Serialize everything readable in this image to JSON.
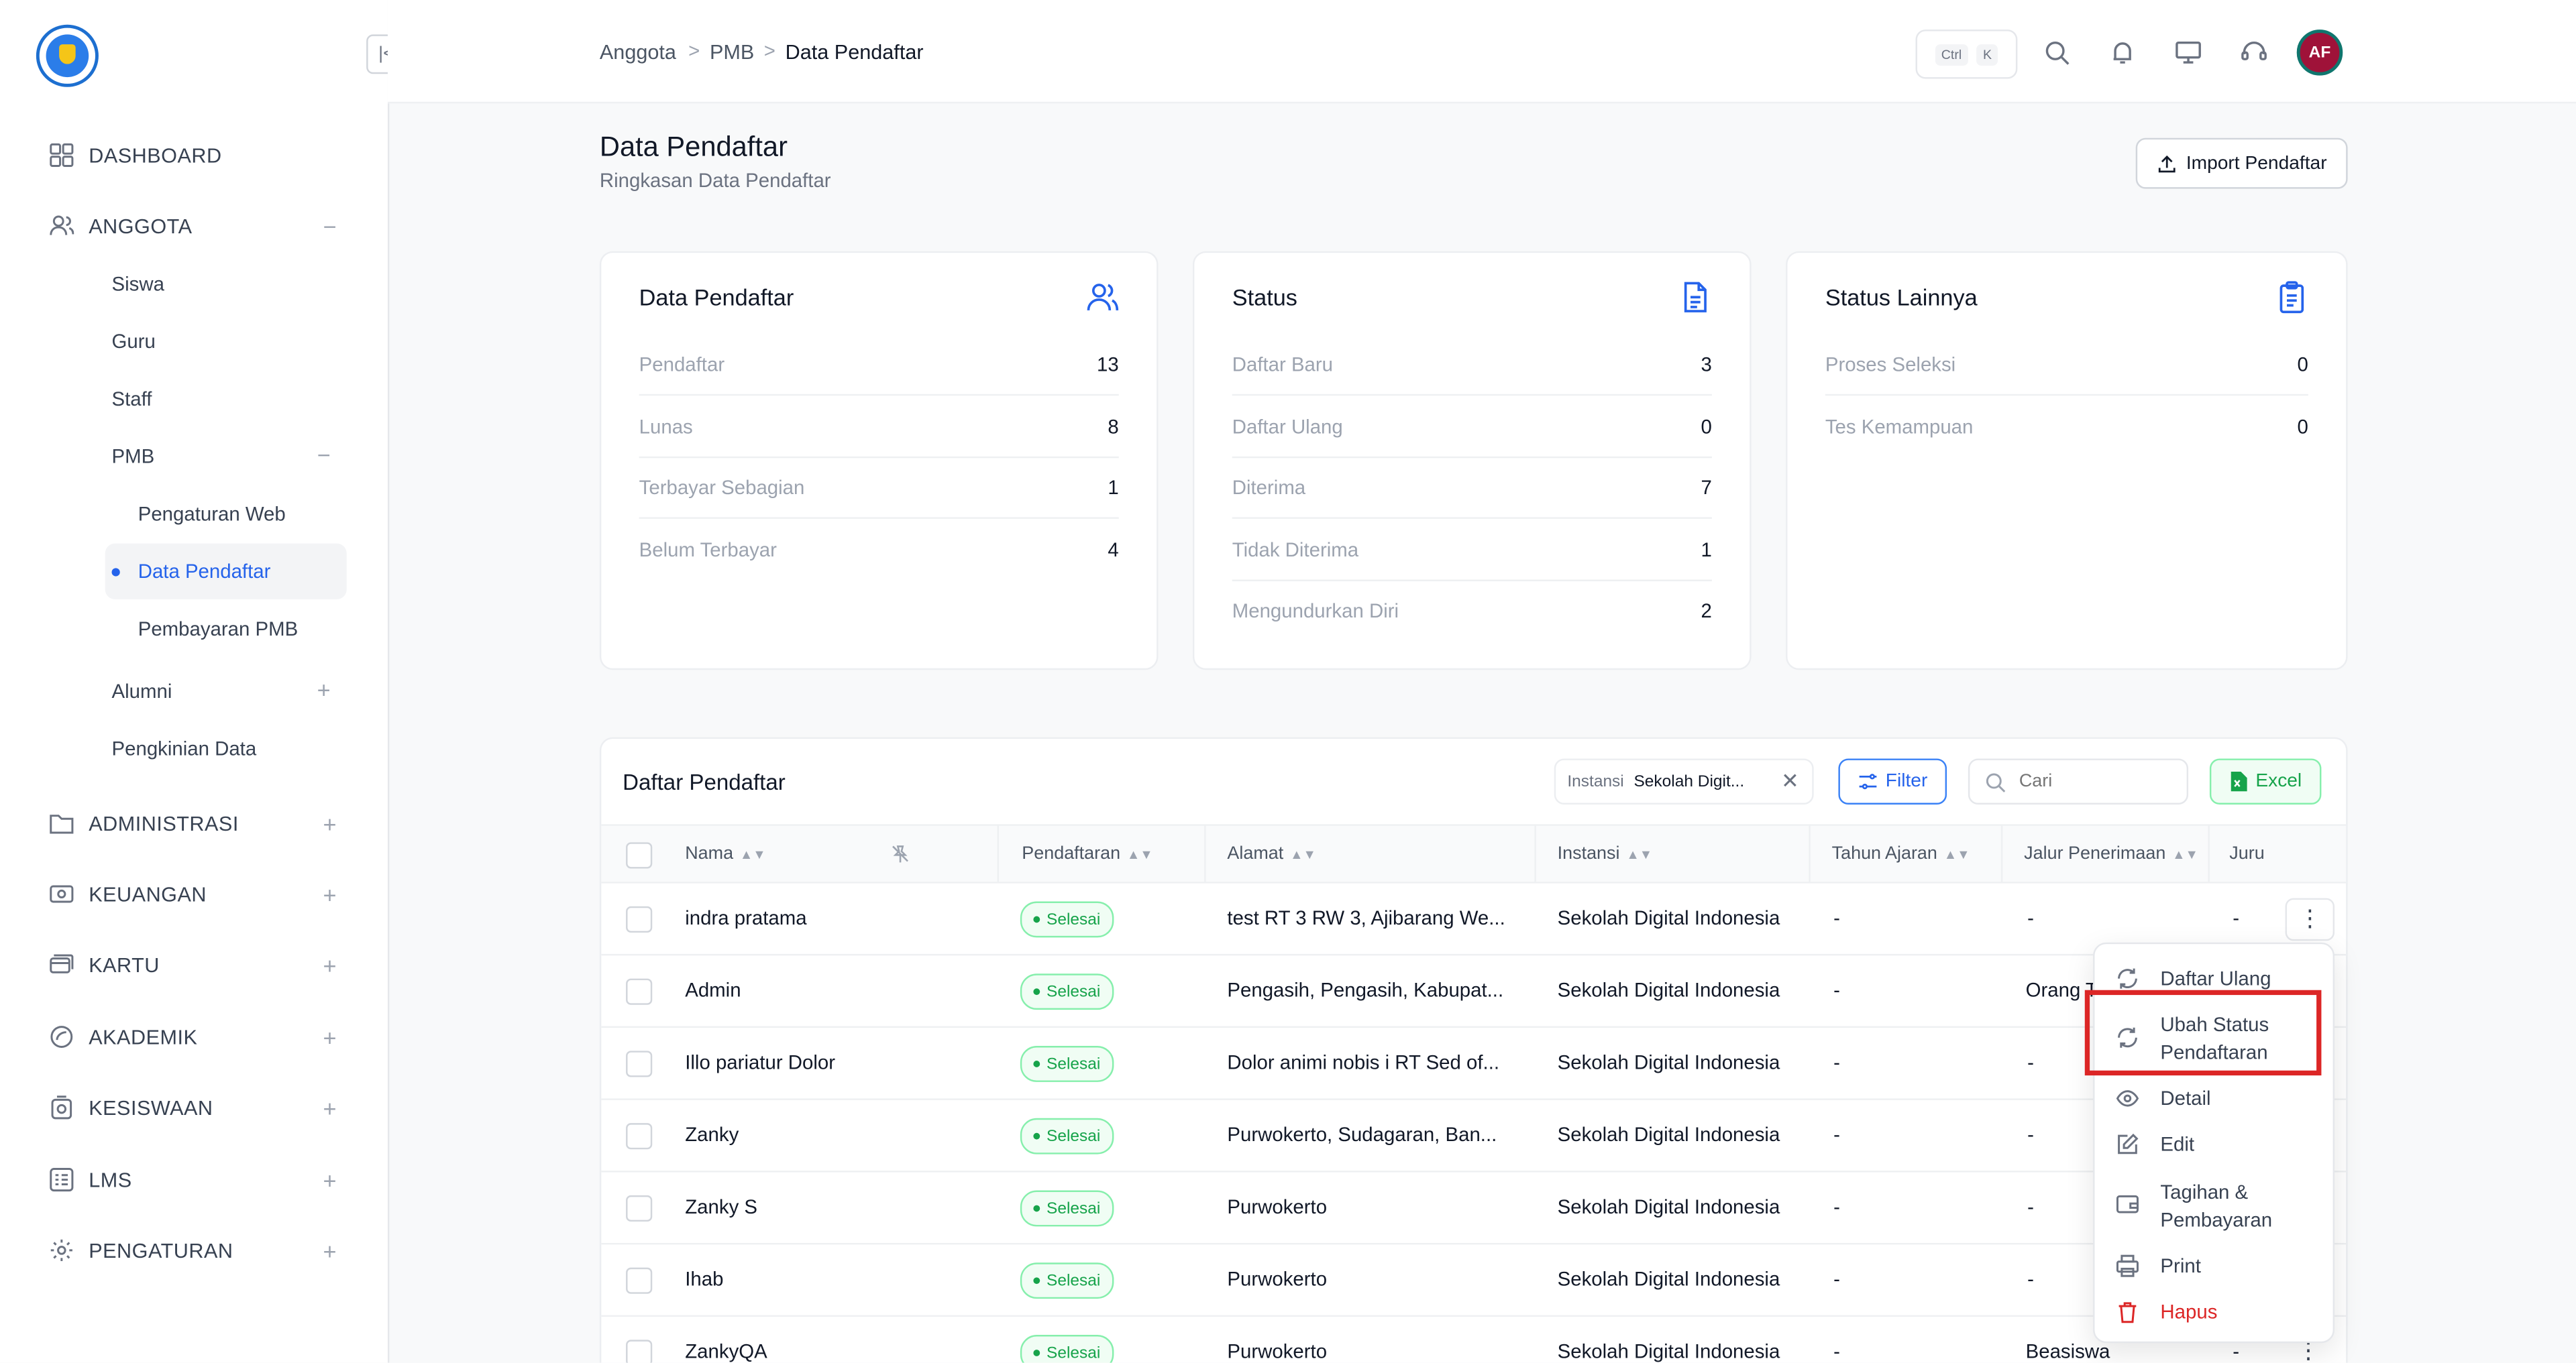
{
  "sidebar": {
    "items": [
      {
        "label": "DASHBOARD",
        "icon": "dashboard-icon",
        "toggle": ""
      },
      {
        "label": "ANGGOTA",
        "icon": "users-icon",
        "toggle": "−"
      },
      {
        "label": "ADMINISTRASI",
        "icon": "folder-icon",
        "toggle": "+"
      },
      {
        "label": "KEUANGAN",
        "icon": "money-icon",
        "toggle": "+"
      },
      {
        "label": "KARTU",
        "icon": "card-icon",
        "toggle": "+"
      },
      {
        "label": "AKADEMIK",
        "icon": "academic-icon",
        "toggle": "+"
      },
      {
        "label": "KESISWAAN",
        "icon": "student-icon",
        "toggle": "+"
      },
      {
        "label": "LMS",
        "icon": "lms-icon",
        "toggle": "+"
      },
      {
        "label": "PENGATURAN",
        "icon": "settings-icon",
        "toggle": "+"
      }
    ],
    "anggota_sub": [
      "Siswa",
      "Guru",
      "Staff",
      "PMB",
      "Alumni",
      "Pengkinian Data"
    ],
    "pmb_toggle": "−",
    "alumni_toggle": "+",
    "pmb_sub": [
      "Pengaturan Web",
      "Data Pendaftar",
      "Pembayaran PMB"
    ]
  },
  "breadcrumb": [
    "Anggota",
    "PMB",
    "Data Pendaftar"
  ],
  "breadcrumb_sep": ">",
  "kbd": [
    "Ctrl",
    "K"
  ],
  "avatar": "AF",
  "page": {
    "title": "Data Pendaftar",
    "subtitle": "Ringkasan Data Pendaftar",
    "import_label": "Import Pendaftar"
  },
  "cards": [
    {
      "title": "Data Pendaftar",
      "icon": "users-icon",
      "rows": [
        {
          "label": "Pendaftar",
          "value": "13"
        },
        {
          "label": "Lunas",
          "value": "8"
        },
        {
          "label": "Terbayar Sebagian",
          "value": "1"
        },
        {
          "label": "Belum Terbayar",
          "value": "4"
        }
      ]
    },
    {
      "title": "Status",
      "icon": "document-icon",
      "rows": [
        {
          "label": "Daftar Baru",
          "value": "3"
        },
        {
          "label": "Daftar Ulang",
          "value": "0"
        },
        {
          "label": "Diterima",
          "value": "7"
        },
        {
          "label": "Tidak Diterima",
          "value": "1"
        },
        {
          "label": "Mengundurkan Diri",
          "value": "2"
        }
      ]
    },
    {
      "title": "Status Lainnya",
      "icon": "clipboard-icon",
      "rows": [
        {
          "label": "Proses Seleksi",
          "value": "0"
        },
        {
          "label": "Tes Kemampuan",
          "value": "0"
        }
      ]
    }
  ],
  "table": {
    "title": "Daftar Pendaftar",
    "filter_chip": {
      "key": "Instansi",
      "value": "Sekolah Digit..."
    },
    "filter_label": "Filter",
    "search_placeholder": "Cari",
    "excel_label": "Excel",
    "columns": [
      "Nama",
      "Pendaftaran",
      "Alamat",
      "Instansi",
      "Tahun Ajaran",
      "Jalur Penerimaan",
      "Juru"
    ],
    "rows": [
      {
        "nama": "indra pratama",
        "status": "Selesai",
        "alamat": "test RT 3 RW 3, Ajibarang We...",
        "instansi": "Sekolah Digital Indonesia",
        "tahun": "-",
        "jalur": "-",
        "juru": "-"
      },
      {
        "nama": "Admin",
        "status": "Selesai",
        "alamat": "Pengasih, Pengasih, Kabupat...",
        "instansi": "Sekolah Digital Indonesia",
        "tahun": "-",
        "jalur": "Orang T",
        "juru": ""
      },
      {
        "nama": "Illo pariatur Dolor",
        "status": "Selesai",
        "alamat": "Dolor animi nobis i RT Sed of...",
        "instansi": "Sekolah Digital Indonesia",
        "tahun": "-",
        "jalur": "-",
        "juru": ""
      },
      {
        "nama": "Zanky",
        "status": "Selesai",
        "alamat": "Purwokerto, Sudagaran, Ban...",
        "instansi": "Sekolah Digital Indonesia",
        "tahun": "-",
        "jalur": "-",
        "juru": ""
      },
      {
        "nama": "Zanky S",
        "status": "Selesai",
        "alamat": "Purwokerto",
        "instansi": "Sekolah Digital Indonesia",
        "tahun": "-",
        "jalur": "-",
        "juru": ""
      },
      {
        "nama": "Ihab",
        "status": "Selesai",
        "alamat": "Purwokerto",
        "instansi": "Sekolah Digital Indonesia",
        "tahun": "-",
        "jalur": "-",
        "juru": ""
      },
      {
        "nama": "ZankyQA",
        "status": "Selesai",
        "alamat": "Purwokerto",
        "instansi": "Sekolah Digital Indonesia",
        "tahun": "-",
        "jalur": "Beasiswa",
        "juru": "-"
      }
    ]
  },
  "context_menu": [
    {
      "label": "Daftar Ulang",
      "icon": "refresh-icon",
      "color": "#374151"
    },
    {
      "label": "Ubah Status Pendaftaran",
      "icon": "refresh-icon",
      "color": "#374151"
    },
    {
      "label": "Detail",
      "icon": "eye-icon",
      "color": "#374151"
    },
    {
      "label": "Edit",
      "icon": "edit-icon",
      "color": "#374151"
    },
    {
      "label": "Tagihan & Pembayaran",
      "icon": "wallet-icon",
      "color": "#374151"
    },
    {
      "label": "Print",
      "icon": "print-icon",
      "color": "#374151"
    },
    {
      "label": "Hapus",
      "icon": "trash-icon",
      "color": "#dc2626"
    }
  ],
  "colors": {
    "accent": "#2563eb",
    "success": "#16a34a",
    "danger": "#dc2626",
    "highlight": "#dc2626"
  }
}
